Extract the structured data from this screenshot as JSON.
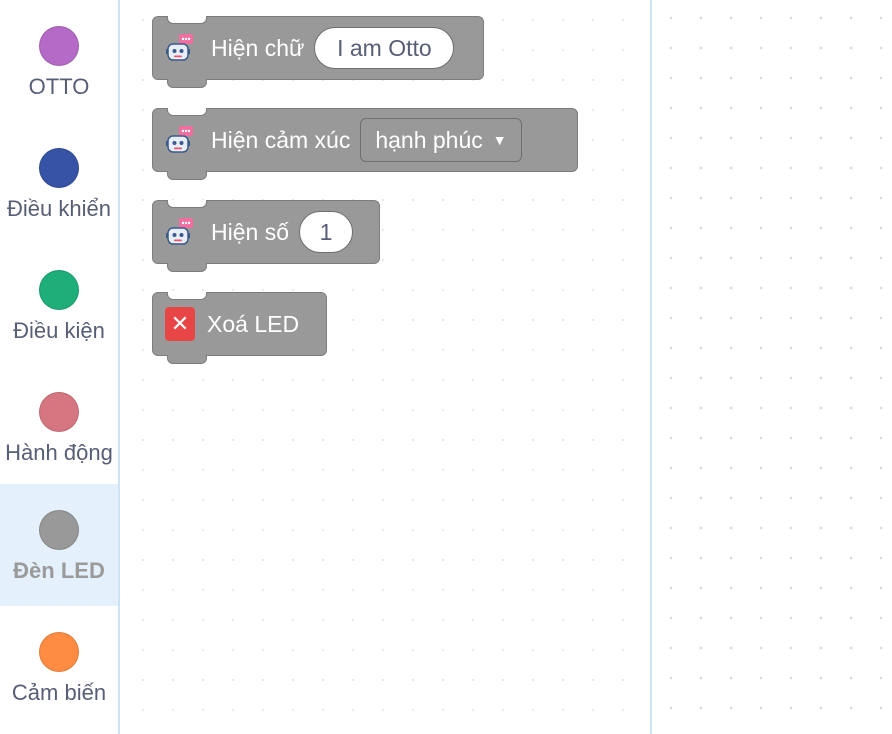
{
  "sidebar": {
    "categories": [
      {
        "label": "OTTO",
        "color": "#b46ac6"
      },
      {
        "label": "Điều khiển",
        "color": "#3653a6"
      },
      {
        "label": "Điều kiện",
        "color": "#1eae79"
      },
      {
        "label": "Hành động",
        "color": "#d67680"
      },
      {
        "label": "Đèn LED",
        "color": "#999999",
        "selected": true
      },
      {
        "label": "Cảm biến",
        "color": "#ff8c42"
      }
    ]
  },
  "flyout": {
    "blocks": [
      {
        "icon": "robot-chat-icon",
        "text": "Hiện chữ",
        "input": "I am Otto"
      },
      {
        "icon": "robot-chat-icon",
        "text": "Hiện cảm xúc",
        "dropdown": "hạnh phúc"
      },
      {
        "icon": "robot-chat-icon",
        "text": "Hiện số",
        "input": "1"
      },
      {
        "icon": "clear-x-icon",
        "icon_glyph": "✕",
        "text": "Xoá LED"
      }
    ]
  },
  "colors": {
    "block_fill": "#999999",
    "block_border": "#7d7d7d",
    "sidebar_divider": "#cfe3f6",
    "selected_category_bg": "#e4f1fc"
  }
}
